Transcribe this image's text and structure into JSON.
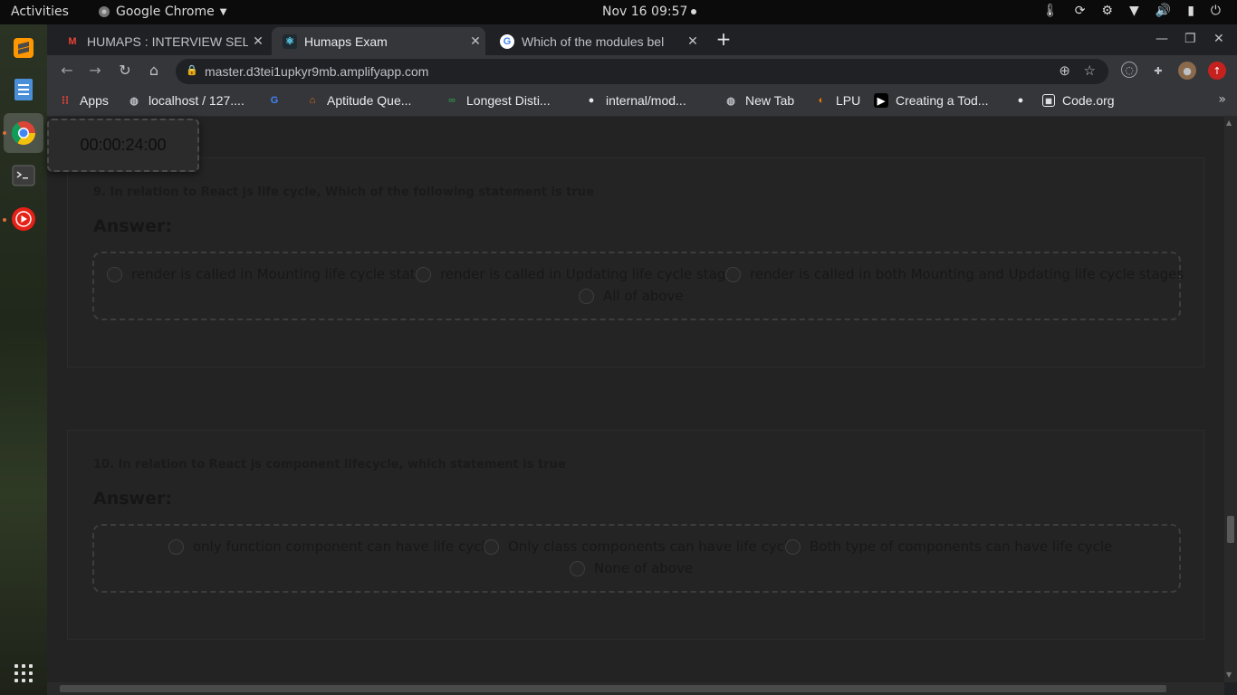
{
  "topbar": {
    "activities": "Activities",
    "app_name": "Google Chrome",
    "clock": "Nov 16  09:57"
  },
  "dock": {
    "items": [
      "sublime-text-icon",
      "text-editor-icon",
      "chrome-icon",
      "terminal-icon",
      "youtube-music-icon"
    ],
    "show_apps": "apps-grid-icon"
  },
  "browser": {
    "tabs": [
      {
        "title": "HUMAPS : INTERVIEW SEL",
        "icon": "gmail-icon"
      },
      {
        "title": "Humaps Exam",
        "icon": "react-icon"
      },
      {
        "title": "Which of the modules bel",
        "icon": "google-icon"
      }
    ],
    "url": "master.d3tei1upkyr9mb.amplifyapp.com",
    "bookmarks": [
      {
        "label": "Apps",
        "icon": "apps-icon"
      },
      {
        "label": "localhost / 127....",
        "icon": "globe-icon"
      },
      {
        "label": "",
        "icon": "google-icon"
      },
      {
        "label": "Aptitude Que...",
        "icon": "bookmark-icon"
      },
      {
        "label": "Longest Disti...",
        "icon": "gfg-icon"
      },
      {
        "label": "internal/mod...",
        "icon": "github-icon"
      },
      {
        "label": "New Tab",
        "icon": "globe-icon"
      },
      {
        "label": "LPU",
        "icon": "lpu-icon"
      },
      {
        "label": "Creating a Tod...",
        "icon": "video-icon"
      },
      {
        "label": "",
        "icon": "github-icon"
      },
      {
        "label": "Code.org",
        "icon": "codeorg-icon"
      }
    ]
  },
  "exam": {
    "timer": "00:00:24:00",
    "answer_label": "Answer:",
    "questions": [
      {
        "text": "9. In relation to React js life cycle, Which of the following statement is true",
        "options": [
          "render is called in Mounting life cycle state",
          "render is called in Updating life cycle stage",
          "render is called in both Mounting and Updating life cycle stages",
          "All of above"
        ]
      },
      {
        "text": "10. In relation to React js component lifecycle, which statement is true",
        "options": [
          "only function component can have life cycle",
          "Only class components can have life cycle",
          "Both type of components can have life cycle",
          "None of above"
        ]
      }
    ]
  }
}
